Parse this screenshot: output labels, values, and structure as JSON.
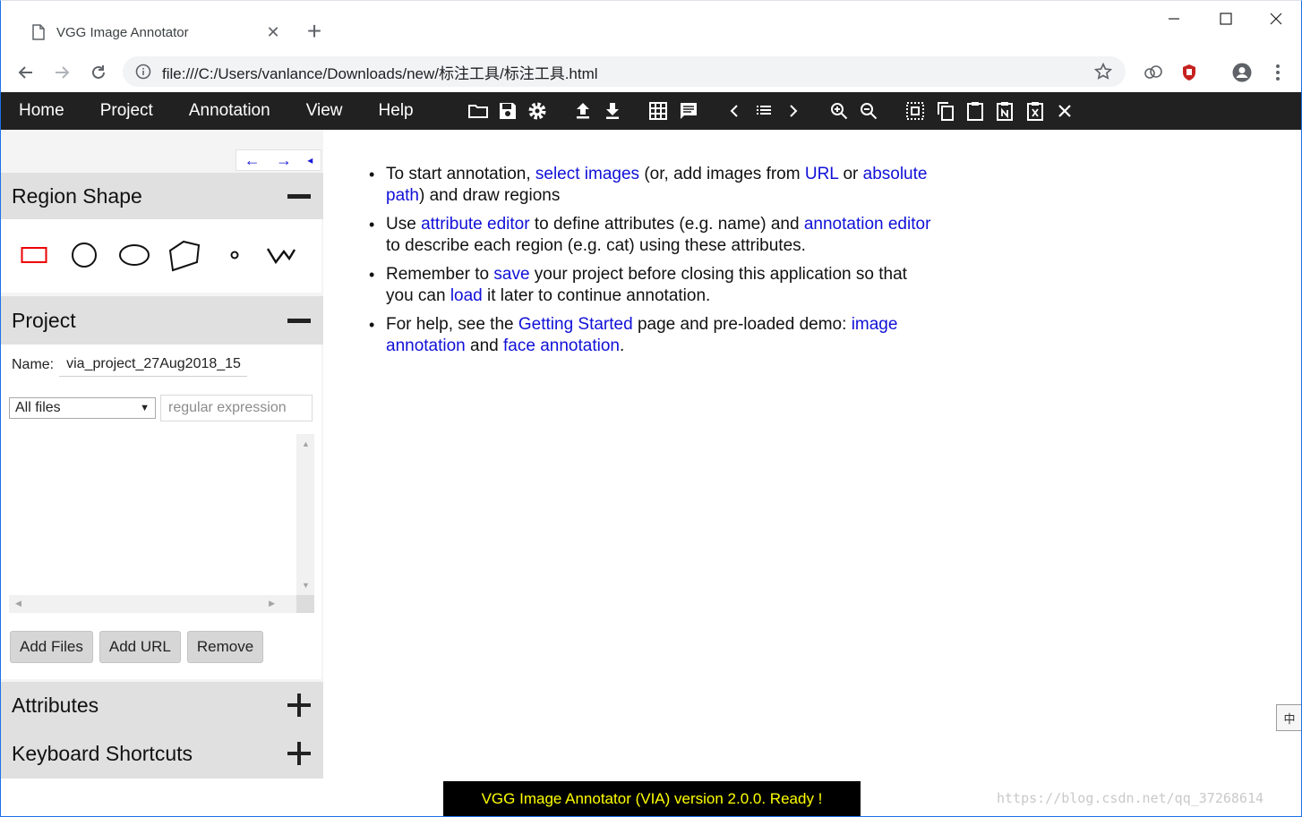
{
  "browser": {
    "tab_title": "VGG Image Annotator",
    "url": "file:///C:/Users/vanlance/Downloads/new/标注工具/标注工具.html",
    "accent_color": "#1a73e8"
  },
  "menu": {
    "items": [
      "Home",
      "Project",
      "Annotation",
      "View",
      "Help"
    ],
    "background": "#212121"
  },
  "toolbar_icons": [
    "folder-open-icon",
    "save-icon",
    "settings-icon",
    "upload-icon",
    "download-icon",
    "grid-view-icon",
    "comment-icon",
    "prev-icon",
    "list-icon",
    "next-icon",
    "zoom-in-icon",
    "zoom-out-icon",
    "select-all-icon",
    "copy-icon",
    "paste-icon",
    "paste-n-icon",
    "paste-x-icon",
    "close-icon"
  ],
  "left_panel": {
    "nav_arrows": [
      "←",
      "→",
      "◂"
    ],
    "region_shape": {
      "title": "Region Shape",
      "shapes": [
        "rectangle",
        "circle",
        "ellipse",
        "polygon",
        "point",
        "polyline"
      ]
    },
    "project": {
      "title": "Project",
      "name_label": "Name:",
      "name_value": "via_project_27Aug2018_15",
      "filter_selected": "All files",
      "regex_placeholder": "regular expression",
      "buttons": {
        "add_files": "Add Files",
        "add_url": "Add URL",
        "remove": "Remove"
      }
    },
    "attributes": {
      "title": "Attributes"
    },
    "keyboard_shortcuts": {
      "title": "Keyboard Shortcuts"
    }
  },
  "content": {
    "b1": {
      "t1": "To start annotation, ",
      "l1": "select images",
      "t2": " (or, add images from ",
      "l2": "URL",
      "t3": " or ",
      "l3": "absolute path",
      "t4": ") and draw regions"
    },
    "b2": {
      "t1": "Use ",
      "l1": "attribute editor",
      "t2": " to define attributes (e.g. name) and ",
      "l2": "annotation editor",
      "t3": " to describe each region (e.g. cat) using these attributes."
    },
    "b3": {
      "t1": "Remember to ",
      "l1": "save",
      "t2": " your project before closing this application so that you can ",
      "l2": "load",
      "t3": " it later to continue annotation."
    },
    "b4": {
      "t1": "For help, see the ",
      "l1": "Getting Started",
      "t2": " page and pre-loaded demo: ",
      "l2": "image annotation",
      "t3": " and ",
      "l3": "face annotation",
      "t4": "."
    },
    "link_color": "#1010d8"
  },
  "status": {
    "text": "VGG Image Annotator (VIA) version 2.0.0. Ready !",
    "text_color": "#ffff00"
  },
  "watermark": "https://blog.csdn.net/qq_37268614",
  "ime_indicator": "中"
}
